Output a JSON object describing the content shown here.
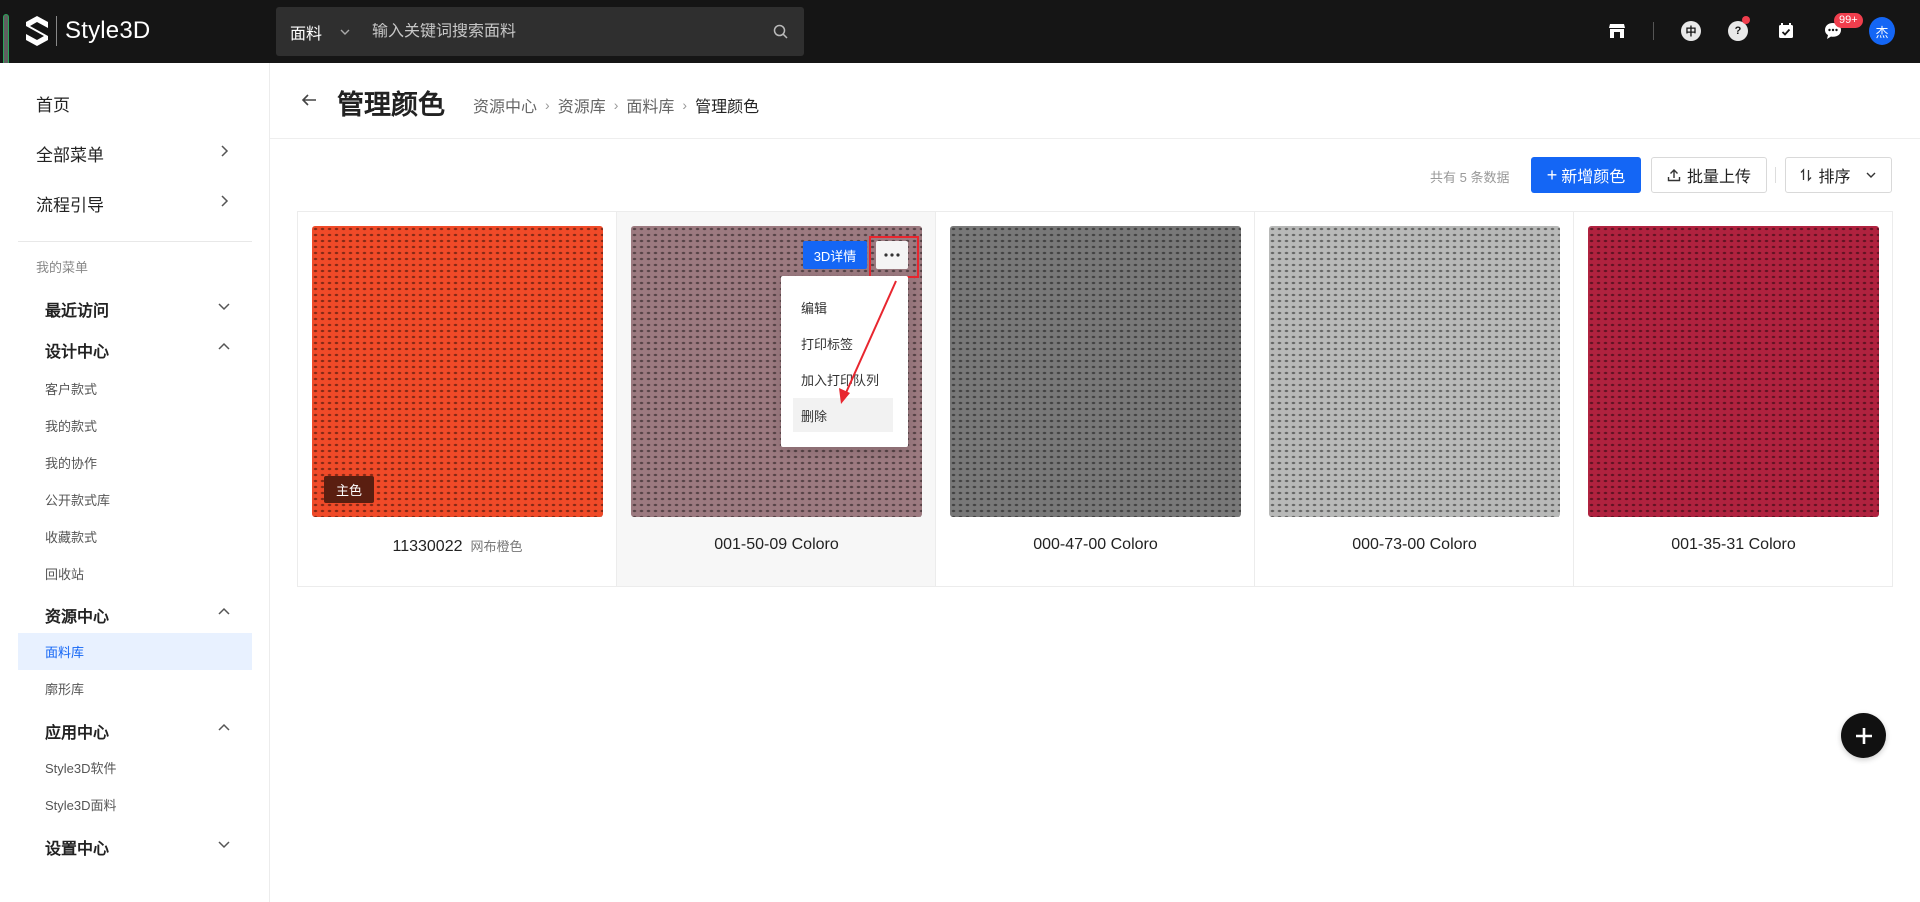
{
  "app": {
    "logo_text": "Style3D"
  },
  "search": {
    "category": "面料",
    "placeholder": "输入关键词搜索面料"
  },
  "topbar": {
    "lang_label": "中",
    "help_label": "?",
    "message_badge": "99+",
    "avatar_text": "杰"
  },
  "sidebar": {
    "home": "首页",
    "all_menu": "全部菜单",
    "flow_guide": "流程引导",
    "my_menu_caption": "我的菜单",
    "groups": {
      "recent": "最近访问",
      "design": "设计中心",
      "resource": "资源中心",
      "apps": "应用中心",
      "settings": "设置中心"
    },
    "design_items": [
      "客户款式",
      "我的款式",
      "我的协作",
      "公开款式库",
      "收藏款式",
      "回收站"
    ],
    "resource_items": [
      "面料库",
      "廓形库"
    ],
    "app_items": [
      "Style3D软件",
      "Style3D面料"
    ]
  },
  "header": {
    "title": "管理颜色",
    "breadcrumbs": [
      "资源中心",
      "资源库",
      "面料库",
      "管理颜色"
    ]
  },
  "toolbar": {
    "count_text": "共有 5 条数据",
    "add_color": "新增颜色",
    "batch_upload": "批量上传",
    "sort": "排序"
  },
  "colors": [
    {
      "code": "11330022",
      "name": "网布橙色",
      "hex": "#f04a28",
      "main_tag": "主色"
    },
    {
      "code": "001-50-09 Coloro",
      "name": "",
      "hex": "#9c7a80"
    },
    {
      "code": "000-47-00 Coloro",
      "name": "",
      "hex": "#787878"
    },
    {
      "code": "000-73-00 Coloro",
      "name": "",
      "hex": "#b8b9b8"
    },
    {
      "code": "001-35-31 Coloro",
      "name": "",
      "hex": "#b0223f"
    }
  ],
  "card_actions": {
    "detail_3d": "3D详情"
  },
  "context_menu": [
    "编辑",
    "打印标签",
    "加入打印队列",
    "删除"
  ],
  "accent": {
    "primary": "#1466f5",
    "annotation": "#e8262f"
  }
}
